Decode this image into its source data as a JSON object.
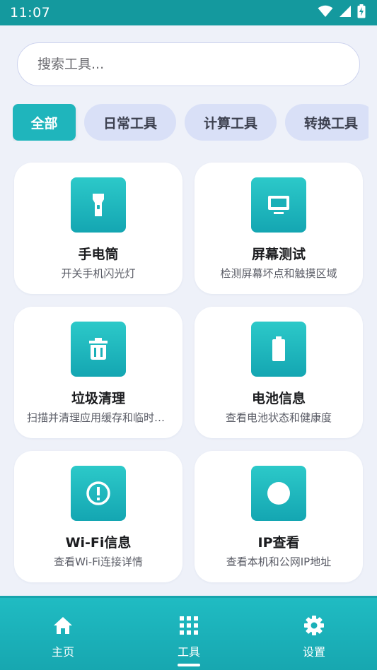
{
  "status_bar": {
    "time": "11:07"
  },
  "search": {
    "placeholder": "搜索工具..."
  },
  "categories": [
    {
      "label": "全部",
      "selected": true
    },
    {
      "label": "日常工具",
      "selected": false
    },
    {
      "label": "计算工具",
      "selected": false
    },
    {
      "label": "转换工具",
      "selected": false
    }
  ],
  "tools": [
    {
      "title": "手电筒",
      "desc": "开关手机闪光灯",
      "icon": "flashlight-icon"
    },
    {
      "title": "屏幕测试",
      "desc": "检测屏幕坏点和触摸区域",
      "icon": "monitor-icon"
    },
    {
      "title": "垃圾清理",
      "desc": "扫描并清理应用缓存和临时文件",
      "icon": "trash-icon"
    },
    {
      "title": "电池信息",
      "desc": "查看电池状态和健康度",
      "icon": "battery-icon"
    },
    {
      "title": "Wi-Fi信息",
      "desc": "查看Wi-Fi连接详情",
      "icon": "info-icon"
    },
    {
      "title": "IP查看",
      "desc": "查看本机和公网IP地址",
      "icon": "circle-icon"
    }
  ],
  "bottom_nav": [
    {
      "label": "主页",
      "icon": "home-icon",
      "active": false
    },
    {
      "label": "工具",
      "icon": "grid-icon",
      "active": true
    },
    {
      "label": "设置",
      "icon": "gear-icon",
      "active": false
    }
  ],
  "colors": {
    "accent": "#1fb5bc",
    "status_bar": "#14999e",
    "background": "#eef1f9",
    "chip_inactive": "#d9e0f7"
  }
}
